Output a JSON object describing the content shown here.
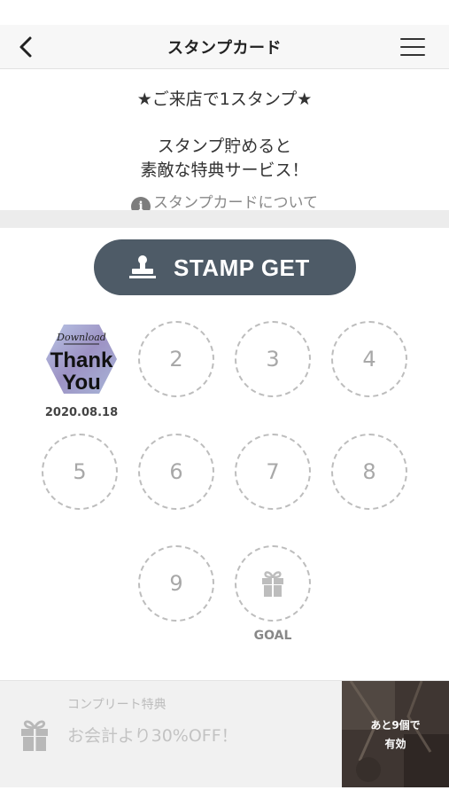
{
  "header": {
    "title": "スタンプカード",
    "back_icon": "chevron-left-icon",
    "menu_icon": "hamburger-menu-icon"
  },
  "intro": {
    "headline": "★ご来店で1スタンプ★",
    "line1": "スタンプ貯めると",
    "line2": "素敵な特典サービス！",
    "about_link": "スタンプカードについて",
    "about_icon": "info-icon"
  },
  "stamp_button": {
    "label": "STAMP GET",
    "icon": "stamp-icon",
    "color": "#4e5b67"
  },
  "stamps": {
    "acquired": {
      "image_text_top": "Download",
      "image_text_main": "Thank You",
      "date": "2020.08.18"
    },
    "slots": [
      "2",
      "3",
      "4",
      "5",
      "6",
      "7",
      "8",
      "9"
    ],
    "goal_icon": "gift-icon",
    "goal_label": "GOAL"
  },
  "reward": {
    "title": "コンプリート特典",
    "description": "お会計より30%OFF！",
    "icon": "gift-icon",
    "remaining_line1": "あと9個で",
    "remaining_line2": "有効"
  }
}
